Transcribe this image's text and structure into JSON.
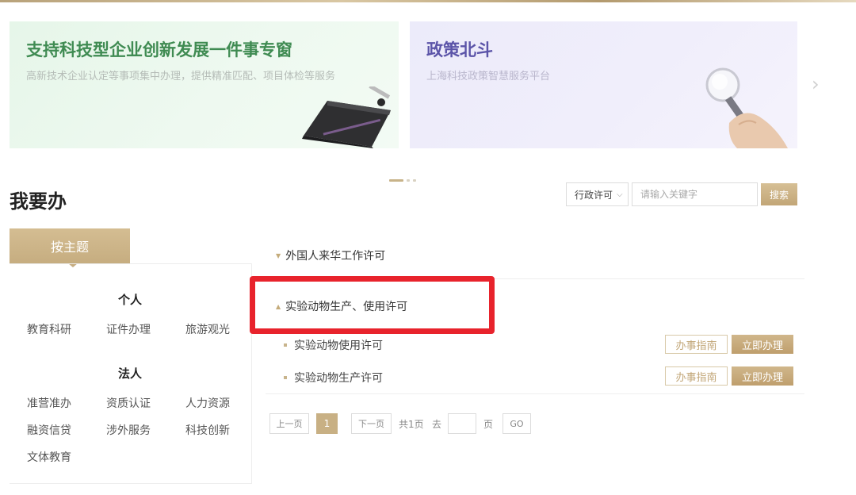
{
  "banners": [
    {
      "title": "支持科技型企业创新发展一件事专窗",
      "subtitle": "高新技术企业认定等事项集中办理，提供精准匹配、项目体检等服务"
    },
    {
      "title": "政策北斗",
      "subtitle": "上海科技政策智慧服务平台"
    }
  ],
  "carousel": {
    "next_icon": "›"
  },
  "section": {
    "title": "我要办"
  },
  "search": {
    "type_value": "行政许可",
    "placeholder": "请输入关键字",
    "button": "搜索"
  },
  "sidebar": {
    "tab": "按主题",
    "personal": {
      "heading": "个人",
      "items": [
        "教育科研",
        "证件办理",
        "旅游观光"
      ]
    },
    "legal": {
      "heading": "法人",
      "items": [
        "准营准办",
        "资质认证",
        "人力资源",
        "融资信贷",
        "涉外服务",
        "科技创新",
        "文体教育"
      ]
    }
  },
  "list": {
    "groups": [
      {
        "label": "外国人来华工作许可",
        "expanded": false
      },
      {
        "label": "实验动物生产、使用许可",
        "expanded": true
      }
    ],
    "items": [
      {
        "label": "实验动物使用许可",
        "guide": "办事指南",
        "apply": "立即办理"
      },
      {
        "label": "实验动物生产许可",
        "guide": "办事指南",
        "apply": "立即办理"
      }
    ]
  },
  "pagination": {
    "prev": "上一页",
    "current": "1",
    "next": "下一页",
    "total": "共1页",
    "goto_label": "去",
    "page_unit": "页",
    "go": "GO"
  },
  "colors": {
    "accent": "#c6ad80",
    "highlight": "#e8232c"
  }
}
